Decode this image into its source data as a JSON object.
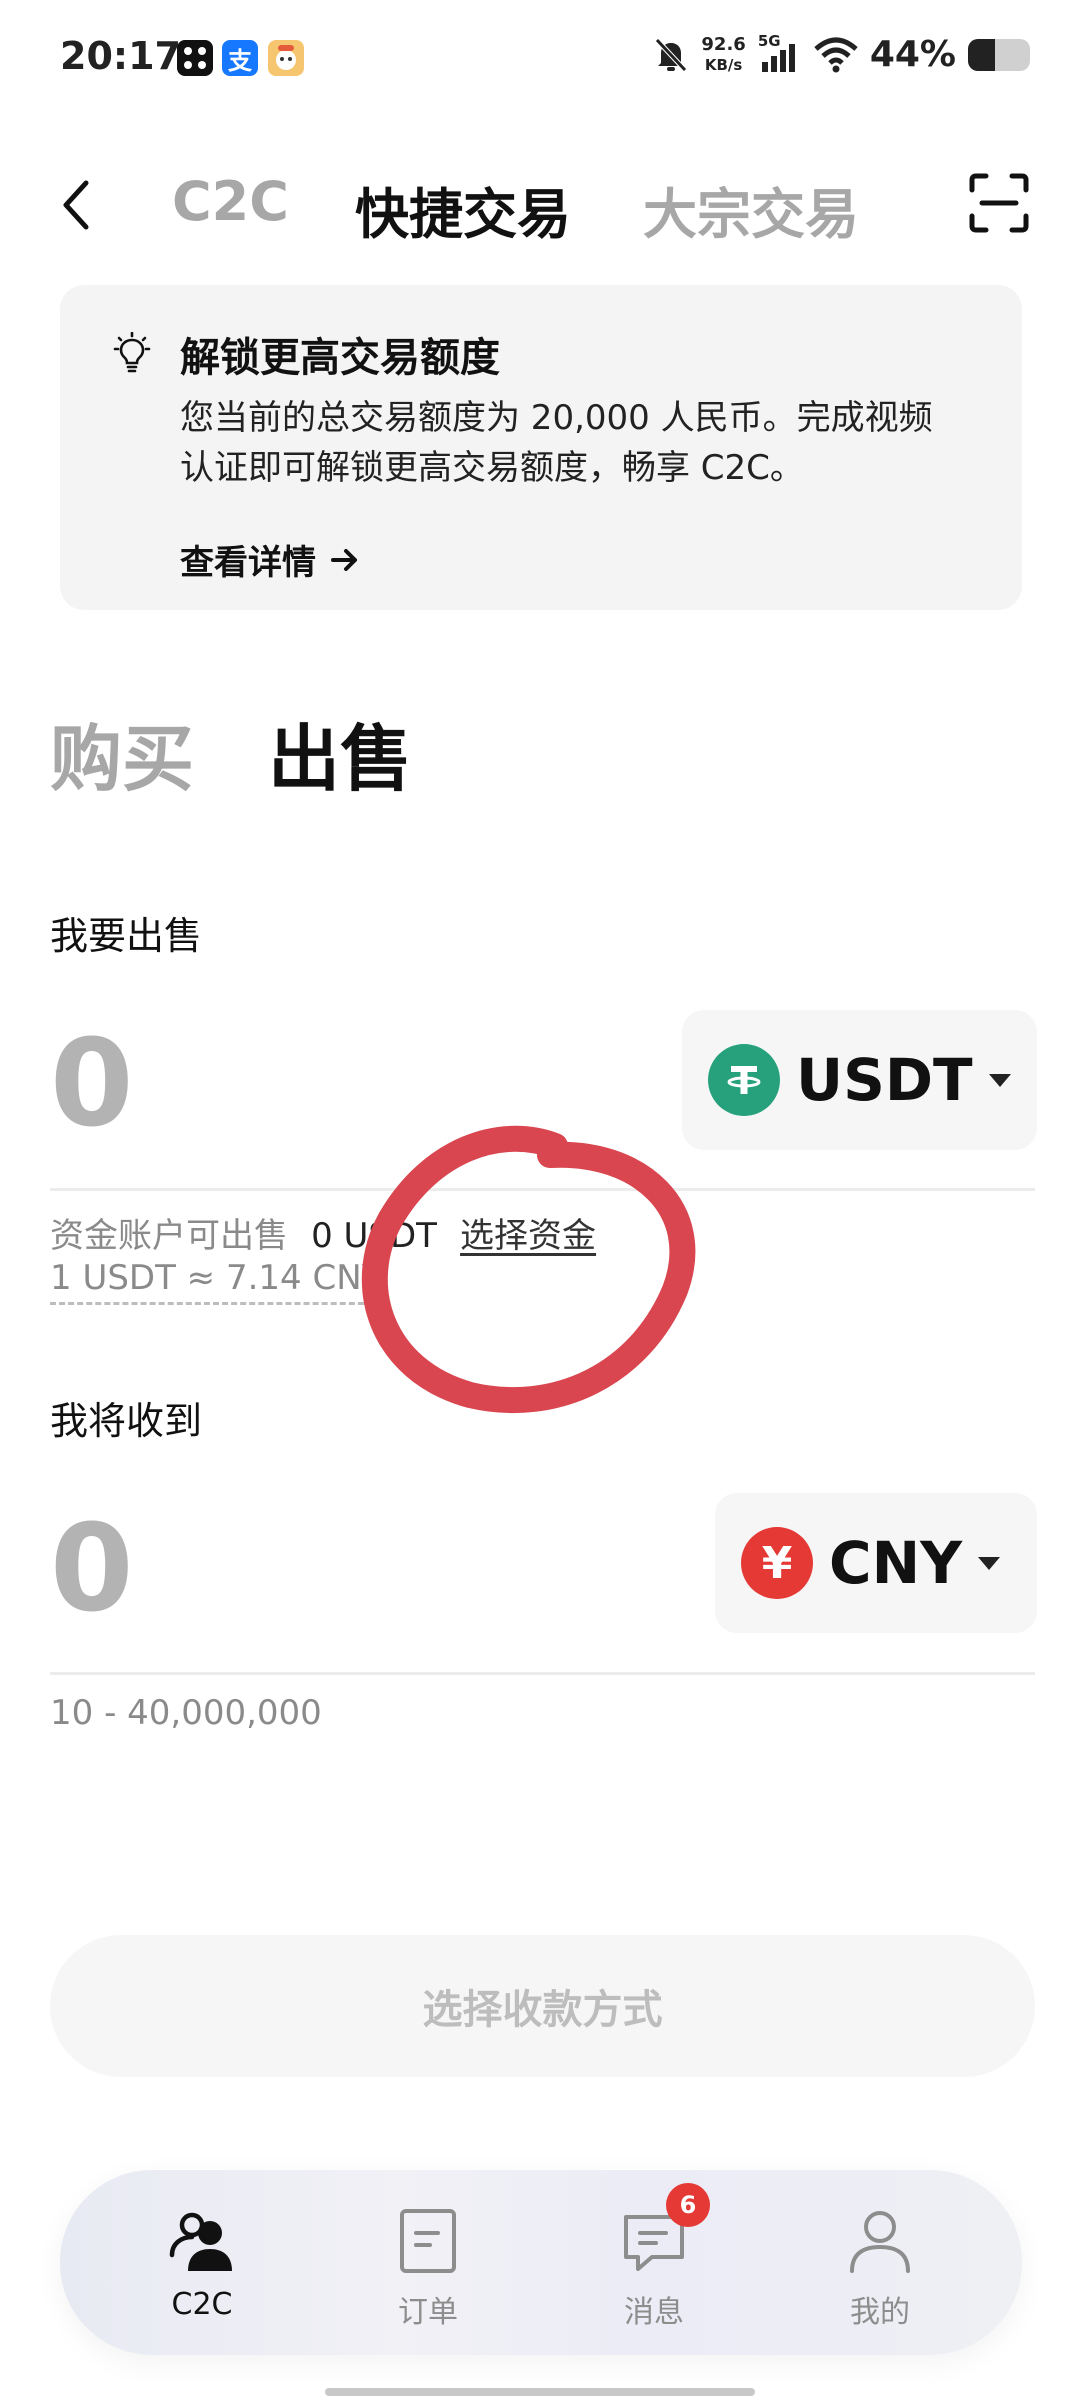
{
  "status_bar": {
    "time": "20:17",
    "net_speed_value": "92.6",
    "net_speed_unit": "KB/s",
    "network": "5G",
    "battery": "44%",
    "battery_level": 0.44
  },
  "header": {
    "tabs": [
      {
        "label": "C2C",
        "active": false
      },
      {
        "label": "快捷交易",
        "active": true
      },
      {
        "label": "大宗交易",
        "active": false
      }
    ]
  },
  "notice": {
    "title": "解锁更高交易额度",
    "body": "您当前的总交易额度为 20,000 人民币。完成视频认证即可解锁更高交易额度，畅享 C2C。",
    "link": "查看详情"
  },
  "trade_tabs": [
    {
      "label": "购买",
      "active": false
    },
    {
      "label": "出售",
      "active": true
    }
  ],
  "sell": {
    "label": "我要出售",
    "amount": "0",
    "currency": "USDT",
    "available_label": "资金账户可出售",
    "available_value": "0 USDT",
    "select_funds": "选择资金",
    "rate": "1 USDT ≈ 7.14 CNY"
  },
  "receive": {
    "label": "我将收到",
    "amount": "0",
    "currency": "CNY",
    "currency_symbol": "¥",
    "range": "10 - 40,000,000"
  },
  "primary_button": "选择收款方式",
  "bottom_nav": [
    {
      "label": "C2C",
      "active": true
    },
    {
      "label": "订单",
      "active": false
    },
    {
      "label": "消息",
      "active": false,
      "badge": "6"
    },
    {
      "label": "我的",
      "active": false
    }
  ],
  "colors": {
    "usdt": "#26A17B",
    "cny": "#E53935",
    "annotation": "#D9464F"
  }
}
